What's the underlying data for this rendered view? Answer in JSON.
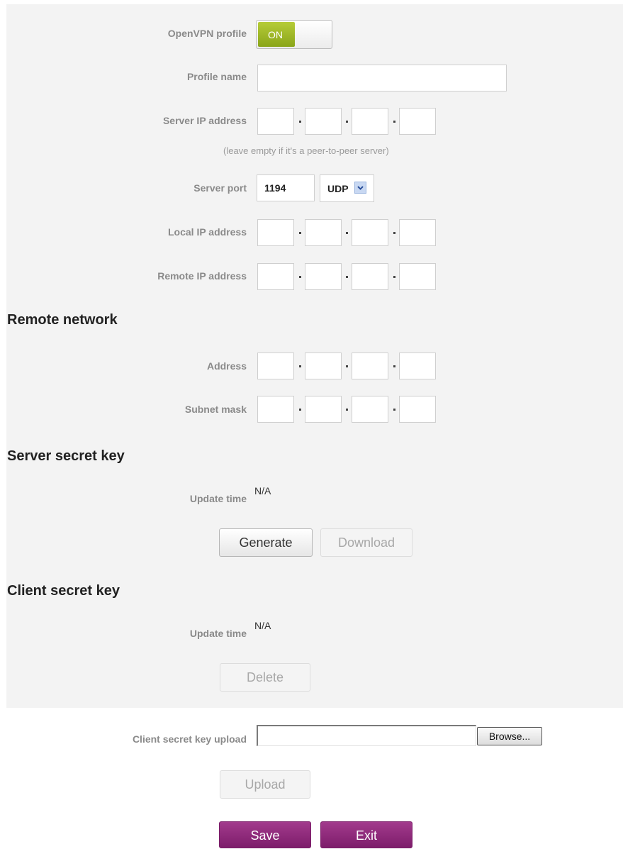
{
  "openvpn_profile": {
    "label": "OpenVPN profile",
    "toggle_state": "ON"
  },
  "profile_name": {
    "label": "Profile name",
    "value": ""
  },
  "server_ip": {
    "label": "Server IP address",
    "hint": "(leave empty if it's a peer-to-peer server)",
    "octets": [
      "",
      "",
      "",
      ""
    ]
  },
  "server_port": {
    "label": "Server port",
    "value": "1194",
    "protocol": "UDP"
  },
  "local_ip": {
    "label": "Local IP address",
    "octets": [
      "",
      "",
      "",
      ""
    ]
  },
  "remote_ip": {
    "label": "Remote IP address",
    "octets": [
      "",
      "",
      "",
      ""
    ]
  },
  "remote_network": {
    "title": "Remote network",
    "address": {
      "label": "Address",
      "octets": [
        "",
        "",
        "",
        ""
      ]
    },
    "subnet_mask": {
      "label": "Subnet mask",
      "octets": [
        "",
        "",
        "",
        ""
      ]
    }
  },
  "server_secret_key": {
    "title": "Server secret key",
    "update_time_label": "Update time",
    "update_time_value": "N/A",
    "generate_label": "Generate",
    "download_label": "Download"
  },
  "client_secret_key": {
    "title": "Client secret key",
    "update_time_label": "Update time",
    "update_time_value": "N/A",
    "delete_label": "Delete"
  },
  "client_upload": {
    "label": "Client secret key upload",
    "browse_label": "Browse...",
    "upload_label": "Upload"
  },
  "footer": {
    "save_label": "Save",
    "exit_label": "Exit"
  },
  "colors": {
    "toggle_on": "#98b41f",
    "primary_button": "#8c2a7a",
    "panel_bg": "#f3f3f3"
  }
}
